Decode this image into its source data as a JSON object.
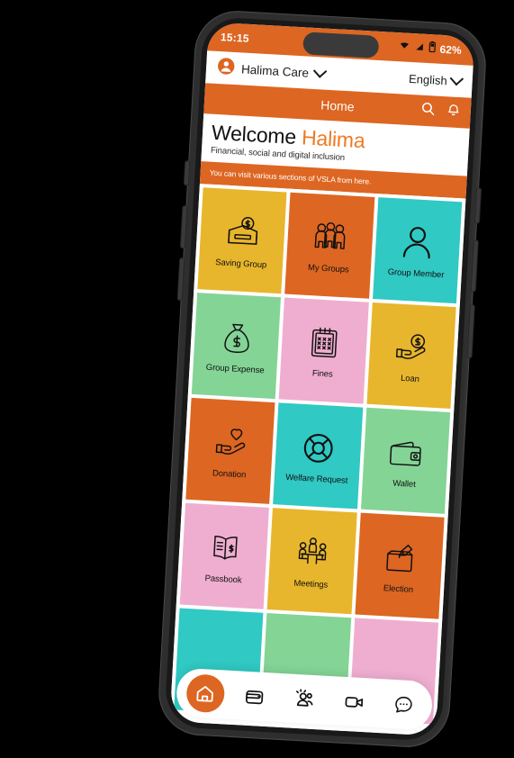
{
  "device": {
    "frame_color": "#2e2e2e",
    "orientation": "portrait"
  },
  "status_bar": {
    "time": "15:15",
    "battery_percent": "62%",
    "wifi_icon": "wifi-icon",
    "signal_icon": "signal-icon",
    "battery_icon": "battery-icon",
    "background": "#DD6622"
  },
  "account_bar": {
    "avatar_icon": "account-avatar-icon",
    "account_name": "Halima Care",
    "account_chevron_icon": "chevron-down-icon",
    "language": "English",
    "language_chevron_icon": "chevron-down-icon"
  },
  "app_bar": {
    "title": "Home",
    "search_icon": "search-icon",
    "notification_icon": "bell-icon",
    "background": "#DD6622"
  },
  "welcome": {
    "greeting": "Welcome",
    "name": "Halima",
    "subtitle": "Financial, social and digital inclusion",
    "name_color": "#EE7A22"
  },
  "hint_banner": {
    "text": "You can visit various sections of VSLA from here."
  },
  "tiles": [
    {
      "label": "Saving Group",
      "color": "#E8B62C",
      "icon": "saving-box-icon"
    },
    {
      "label": "My Groups",
      "color": "#DD6622",
      "icon": "people-group-icon"
    },
    {
      "label": "Group Member",
      "color": "#30C9C3",
      "icon": "person-icon"
    },
    {
      "label": "Group Expense",
      "color": "#84D496",
      "icon": "money-bag-icon"
    },
    {
      "label": "Fines",
      "color": "#EFAED0",
      "icon": "clipboard-x-icon"
    },
    {
      "label": "Loan",
      "color": "#E8B62C",
      "icon": "hand-coin-icon"
    },
    {
      "label": "Donation",
      "color": "#DD6622",
      "icon": "hand-heart-icon"
    },
    {
      "label": "Welfare Request",
      "color": "#30C9C3",
      "icon": "lifebuoy-icon"
    },
    {
      "label": "Wallet",
      "color": "#84D496",
      "icon": "wallet-icon"
    },
    {
      "label": "Passbook",
      "color": "#EFAED0",
      "icon": "passbook-icon"
    },
    {
      "label": "Meetings",
      "color": "#E8B62C",
      "icon": "meeting-table-icon"
    },
    {
      "label": "Election",
      "color": "#DD6622",
      "icon": "ballot-box-icon"
    },
    {
      "label": "",
      "color": "#30C9C3",
      "icon": ""
    },
    {
      "label": "",
      "color": "#84D496",
      "icon": ""
    },
    {
      "label": "",
      "color": "#EFAED0",
      "icon": ""
    }
  ],
  "bottom_nav": {
    "active_color": "#DD6622",
    "items": [
      {
        "icon": "home-icon",
        "active": true
      },
      {
        "icon": "wallet-nav-icon",
        "active": false
      },
      {
        "icon": "group-nav-icon",
        "active": false
      },
      {
        "icon": "video-nav-icon",
        "active": false
      },
      {
        "icon": "more-nav-icon",
        "active": false
      }
    ]
  }
}
